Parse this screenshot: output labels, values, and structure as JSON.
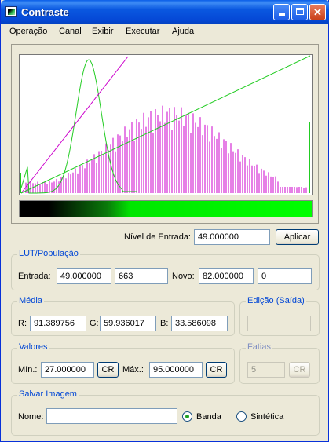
{
  "window": {
    "title": "Contraste"
  },
  "menu": [
    "Operação",
    "Canal",
    "Exibir",
    "Executar",
    "Ajuda"
  ],
  "entrada": {
    "label": "Nível de Entrada:",
    "value": "49.000000",
    "apply_label": "Aplicar"
  },
  "lut": {
    "title": "LUT/População",
    "entrada_label": "Entrada:",
    "entrada_value": "49.000000",
    "entrada_count": "663",
    "novo_label": "Novo:",
    "novo_value": "82.000000",
    "novo_count": "0"
  },
  "media": {
    "title": "Média",
    "r_label": "R:",
    "r_value": "91.389756",
    "g_label": "G:",
    "g_value": "59.936017",
    "b_label": "B:",
    "b_value": "33.586098"
  },
  "edicao": {
    "title": "Edição (Saída)",
    "value": ""
  },
  "valores": {
    "title": "Valores",
    "min_label": "Mín.:",
    "min_value": "27.000000",
    "min_btn": "CR",
    "max_label": "Máx.:",
    "max_value": "95.000000",
    "max_btn": "CR"
  },
  "fatias": {
    "title": "Fatias",
    "value": "5",
    "btn": "CR"
  },
  "salvar": {
    "title": "Salvar Imagem",
    "nome_label": "Nome:",
    "nome_value": "",
    "banda_label": "Banda",
    "sintetica_label": "Sintética"
  },
  "colors": {
    "histogram": "#cc00cc",
    "curve": "#22cc22",
    "titlebar": "#0a58e0"
  }
}
